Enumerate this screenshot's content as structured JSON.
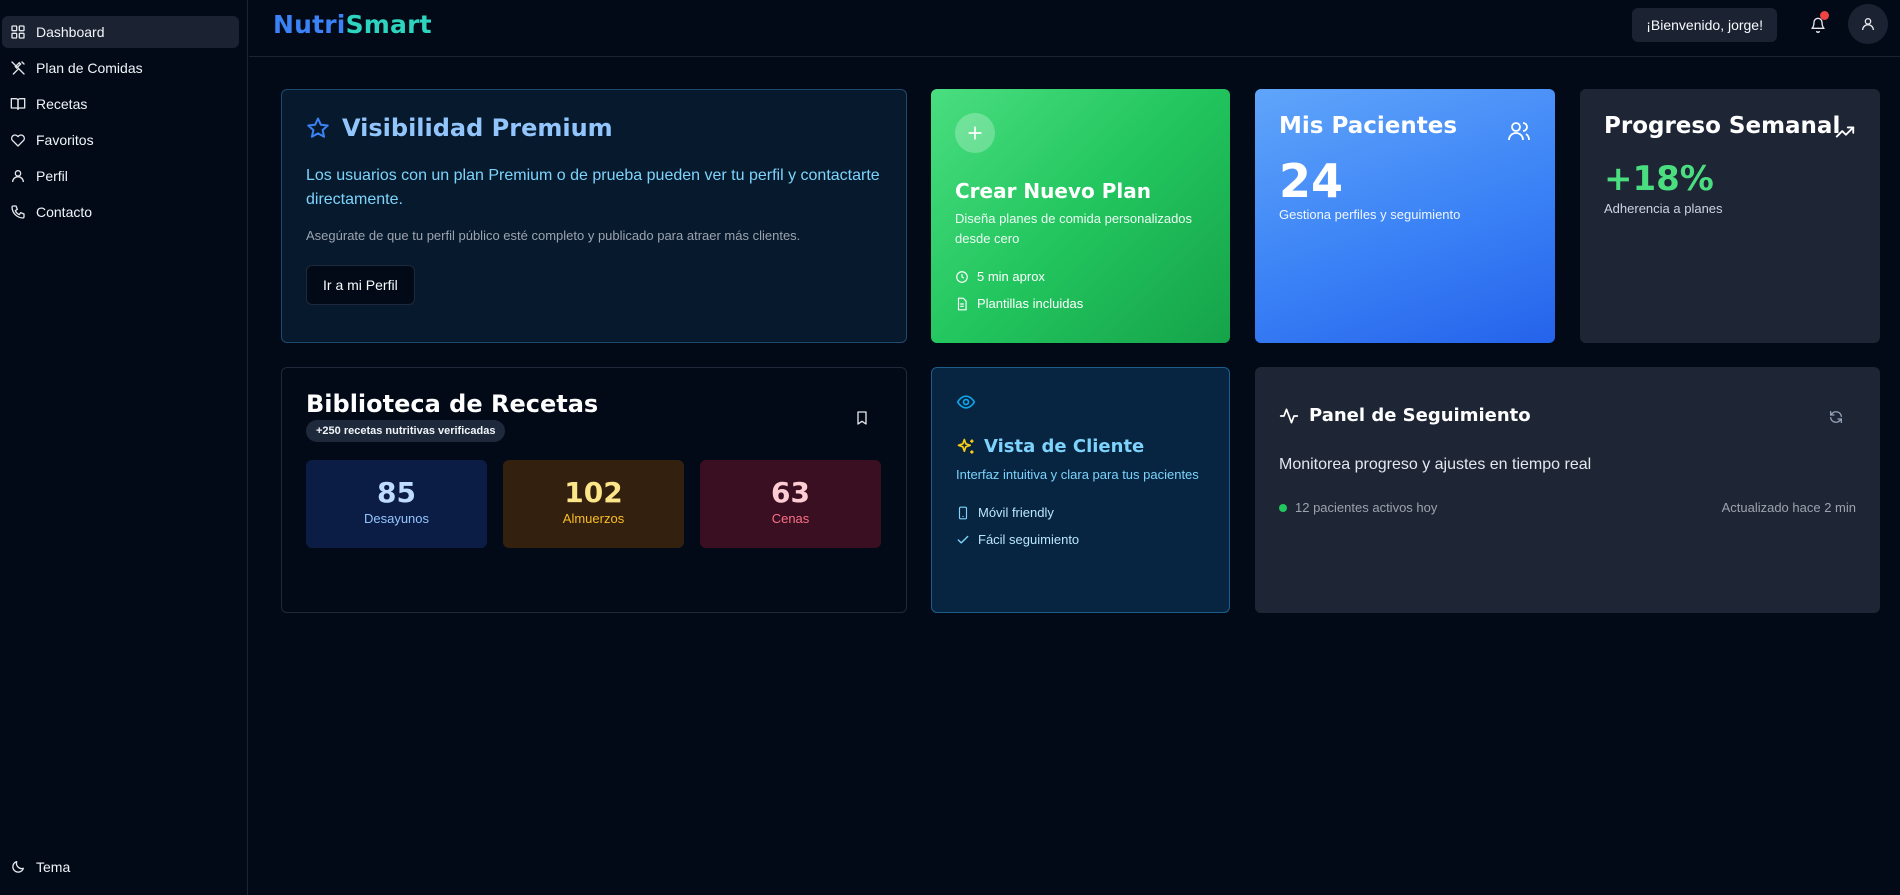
{
  "sidebar": {
    "items": [
      {
        "label": "Dashboard",
        "icon": "grid-icon"
      },
      {
        "label": "Plan de Comidas",
        "icon": "utensils-icon"
      },
      {
        "label": "Recetas",
        "icon": "book-open-icon"
      },
      {
        "label": "Favoritos",
        "icon": "heart-icon"
      },
      {
        "label": "Perfil",
        "icon": "user-icon"
      },
      {
        "label": "Contacto",
        "icon": "phone-icon"
      }
    ],
    "theme_label": "Tema"
  },
  "header": {
    "brand_part1": "Nutri",
    "brand_part2": "Smart",
    "welcome": "¡Bienvenido, jorge!"
  },
  "premium": {
    "title": "Visibilidad Premium",
    "lead": "Los usuarios con un plan Premium o de prueba pueden ver tu perfil y contactarte directamente.",
    "note": "Asegúrate de que tu perfil público esté completo y publicado para atraer más clientes.",
    "button": "Ir a mi Perfil"
  },
  "new_plan": {
    "title": "Crear Nuevo Plan",
    "desc": "Diseña planes de comida personalizados desde cero",
    "feature1": "5 min aprox",
    "feature2": "Plantillas incluidas"
  },
  "patients": {
    "title": "Mis Pacientes",
    "count": "24",
    "sub": "Gestiona perfiles y seguimiento"
  },
  "progress": {
    "title": "Progreso Semanal",
    "value": "+18%",
    "sub": "Adherencia a planes"
  },
  "library": {
    "title": "Biblioteca de Recetas",
    "badge": "+250 recetas nutritivas verificadas",
    "stats": [
      {
        "value": "85",
        "label": "Desayunos"
      },
      {
        "value": "102",
        "label": "Almuerzos"
      },
      {
        "value": "63",
        "label": "Cenas"
      }
    ]
  },
  "client_view": {
    "title": "Vista de Cliente",
    "desc": "Interfaz intuitiva y clara para tus pacientes",
    "feature1": "Móvil friendly",
    "feature2": "Fácil seguimiento"
  },
  "tracking": {
    "title": "Panel de Seguimiento",
    "desc": "Monitorea progreso y ajustes en tiempo real",
    "active": "12 pacientes activos hoy",
    "updated": "Actualizado hace 2 min"
  }
}
